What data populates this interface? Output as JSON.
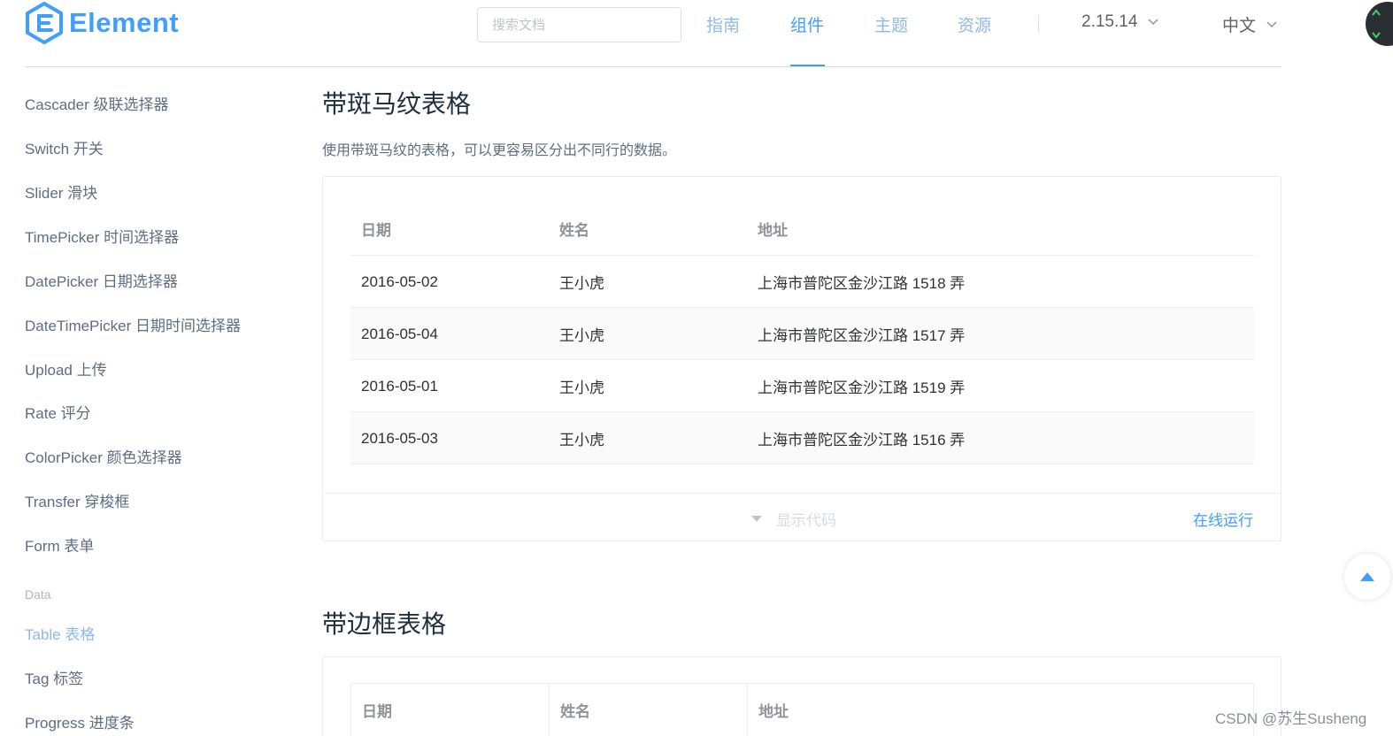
{
  "header": {
    "logo_text": "Element",
    "search_placeholder": "搜索文档",
    "nav": [
      {
        "label": "指南"
      },
      {
        "label": "组件"
      },
      {
        "label": "主题"
      },
      {
        "label": "资源"
      }
    ],
    "active_nav": "组件",
    "version": "2.15.14",
    "language": "中文"
  },
  "sidebar": {
    "items": [
      {
        "label": "Cascader 级联选择器"
      },
      {
        "label": "Switch 开关"
      },
      {
        "label": "Slider 滑块"
      },
      {
        "label": "TimePicker 时间选择器"
      },
      {
        "label": "DatePicker 日期选择器"
      },
      {
        "label": "DateTimePicker 日期时间选择器"
      },
      {
        "label": "Upload 上传"
      },
      {
        "label": "Rate 评分"
      },
      {
        "label": "ColorPicker 颜色选择器"
      },
      {
        "label": "Transfer 穿梭框"
      },
      {
        "label": "Form 表单"
      }
    ],
    "group_label": "Data",
    "data_items": [
      {
        "label": "Table 表格"
      },
      {
        "label": "Tag 标签"
      },
      {
        "label": "Progress 进度条"
      }
    ],
    "active_item": "Table 表格"
  },
  "section1": {
    "title": "带斑马纹表格",
    "description": "使用带斑马纹的表格，可以更容易区分出不同行的数据。",
    "table": {
      "headers": [
        "日期",
        "姓名",
        "地址"
      ],
      "rows": [
        [
          "2016-05-02",
          "王小虎",
          "上海市普陀区金沙江路 1518 弄"
        ],
        [
          "2016-05-04",
          "王小虎",
          "上海市普陀区金沙江路 1517 弄"
        ],
        [
          "2016-05-01",
          "王小虎",
          "上海市普陀区金沙江路 1519 弄"
        ],
        [
          "2016-05-03",
          "王小虎",
          "上海市普陀区金沙江路 1516 弄"
        ]
      ]
    },
    "show_code": "显示代码",
    "run_online": "在线运行"
  },
  "section2": {
    "title": "带边框表格",
    "table": {
      "headers": [
        "日期",
        "姓名",
        "地址"
      ]
    }
  },
  "watermark": "CSDN @苏生Susheng",
  "colors": {
    "accent": "#409eff",
    "text": "#303133",
    "muted": "#909399",
    "stripe": "#fafafa"
  }
}
